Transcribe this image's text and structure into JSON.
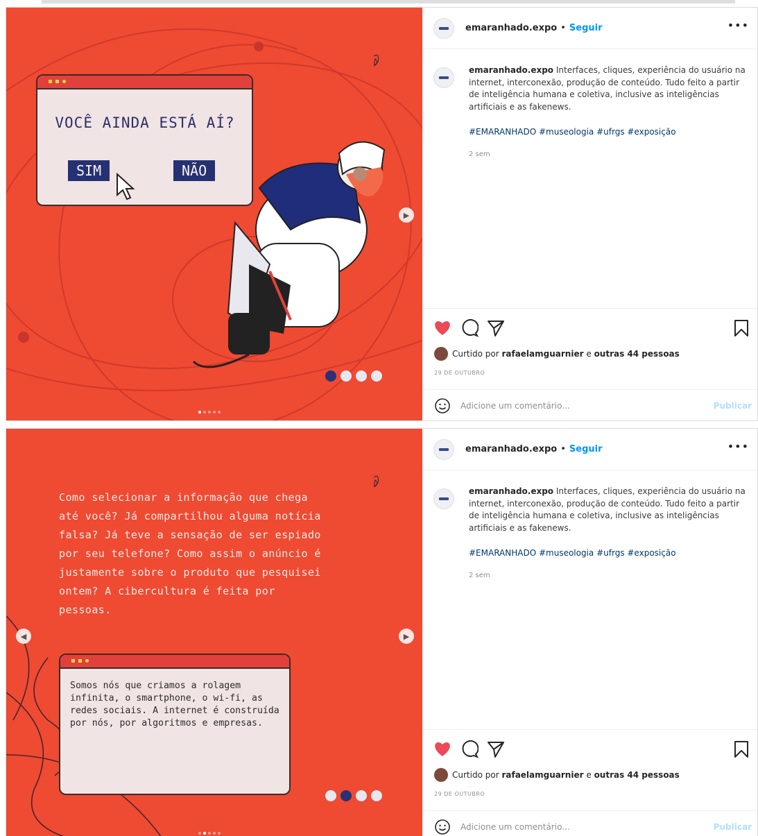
{
  "posts": [
    {
      "header": {
        "username": "emaranhado.expo",
        "separator": "•",
        "follow": "Seguir",
        "more": "•••"
      },
      "caption": {
        "username": "emaranhado.expo",
        "text": "Interfaces, cliques, experiência do usuário na internet, interconexão, produção de conteúdo. Tudo feito a partir de inteligência humana e coletiva, inclusive as inteligências artificiais e as fakenews.",
        "hashtags": "#EMARANHADO #museologia #ufrgs #exposição",
        "time": "2 sem"
      },
      "likes": {
        "prefix": "Curtido por",
        "user": "rafaelamguarnier",
        "middle": "e",
        "rest": "outras 44 pessoas"
      },
      "date": "29 DE OUTUBRO",
      "comment": {
        "placeholder": "Adicione um comentário...",
        "publish": "Publicar"
      },
      "slide": {
        "question": "VOCÊ AINDA ESTÁ AÍ?",
        "yes": "SIM",
        "no": "NÃO",
        "page_index": 1,
        "page_count": 5
      }
    },
    {
      "header": {
        "username": "emaranhado.expo",
        "separator": "•",
        "follow": "Seguir",
        "more": "•••"
      },
      "caption": {
        "username": "emaranhado.expo",
        "text": "Interfaces, cliques, experiência do usuário na internet, interconexão, produção de conteúdo. Tudo feito a partir de inteligência humana e coletiva, inclusive as inteligências artificiais e as fakenews.",
        "hashtags": "#EMARANHADO #museologia #ufrgs #exposição",
        "time": "2 sem"
      },
      "likes": {
        "prefix": "Curtido por",
        "user": "rafaelamguarnier",
        "middle": "e",
        "rest": "outras 44 pessoas"
      },
      "date": "29 DE OUTUBRO",
      "comment": {
        "placeholder": "Adicione um comentário...",
        "publish": "Publicar"
      },
      "slide": {
        "paragraph": "Como selecionar a informação que chega até você? Já compartilhou alguma notícia falsa? Já teve a sensação de ser espiado por seu telefone? Como assim o anúncio é justamente sobre o produto que pesquisei ontem? A cibercultura é feita por pessoas.",
        "window_text": "Somos nós que criamos a rolagem infinita, o smartphone, o wi-fi, as redes sociais. A internet é construída por nós, por algoritmos e empresas.",
        "page_index": 2,
        "page_count": 5
      }
    }
  ],
  "colors": {
    "slide_bg": "#ef4a32",
    "navy": "#263173",
    "link": "#0095f6",
    "heart": "#ed4956"
  },
  "icons": [
    "heart-icon",
    "comment-icon",
    "share-icon",
    "bookmark-icon",
    "emoji-icon",
    "chevron-right-icon",
    "chevron-left-icon",
    "cursor-icon"
  ]
}
